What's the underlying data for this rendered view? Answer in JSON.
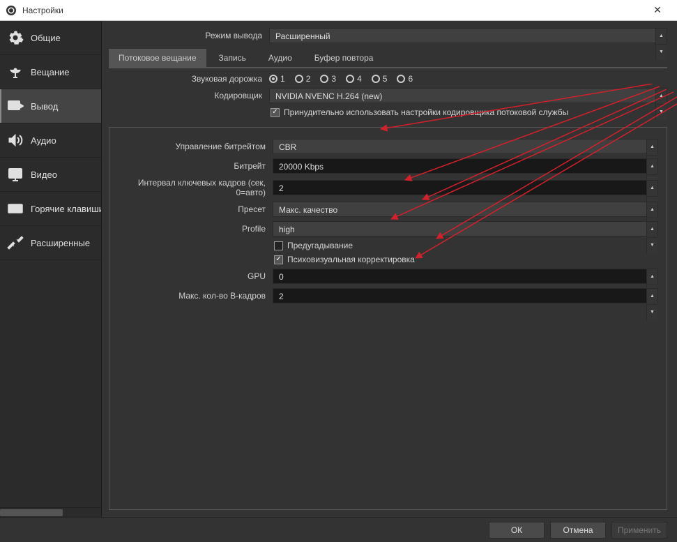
{
  "window": {
    "title": "Настройки"
  },
  "sidebar": {
    "items": [
      {
        "label": "Общие"
      },
      {
        "label": "Вещание"
      },
      {
        "label": "Вывод"
      },
      {
        "label": "Аудио"
      },
      {
        "label": "Видео"
      },
      {
        "label": "Горячие клавиши"
      },
      {
        "label": "Расширенные"
      }
    ]
  },
  "output_mode": {
    "label": "Режим вывода",
    "value": "Расширенный"
  },
  "tabs": {
    "streaming": "Потоковое вещание",
    "recording": "Запись",
    "audio": "Аудио",
    "replay": "Буфер повтора"
  },
  "audio_track": {
    "label": "Звуковая дорожка",
    "options": [
      "1",
      "2",
      "3",
      "4",
      "5",
      "6"
    ]
  },
  "encoder": {
    "label": "Кодировщик",
    "value": "NVIDIA NVENC H.264 (new)"
  },
  "enforce": {
    "label": "Принудительно использовать настройки кодировщика потоковой службы"
  },
  "rate_control": {
    "label": "Управление битрейтом",
    "value": "CBR"
  },
  "bitrate": {
    "label": "Битрейт",
    "value": "20000 Kbps"
  },
  "keyframe": {
    "label": "Интервал ключевых кадров (сек, 0=авто)",
    "value": "2"
  },
  "preset": {
    "label": "Пресет",
    "value": "Макс. качество"
  },
  "profile": {
    "label": "Profile",
    "value": "high"
  },
  "lookahead": {
    "label": "Предугадывание"
  },
  "psycho": {
    "label": "Психовизуальная корректировка"
  },
  "gpu": {
    "label": "GPU",
    "value": "0"
  },
  "bframes": {
    "label": "Макс. кол-во B-кадров",
    "value": "2"
  },
  "footer": {
    "ok": "ОК",
    "cancel": "Отмена",
    "apply": "Применить"
  }
}
